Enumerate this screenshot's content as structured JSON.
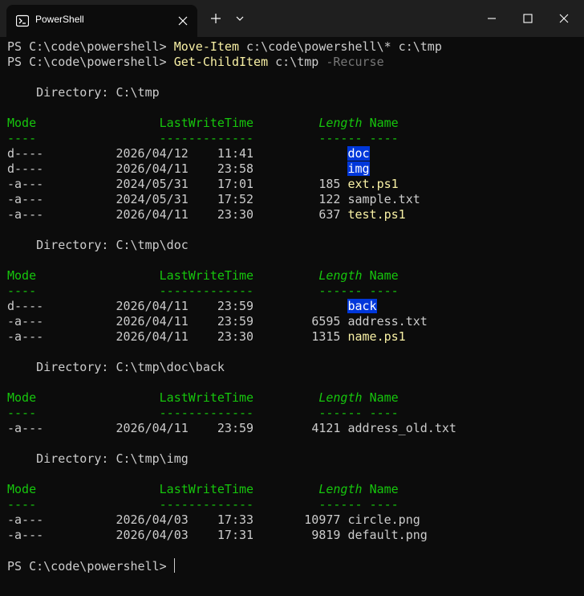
{
  "tab": {
    "title": "PowerShell"
  },
  "prompt": "PS C:\\code\\powershell> ",
  "commands": [
    {
      "name": "Move-Item",
      "args": " c:\\code\\powershell\\* c:\\tmp",
      "param": ""
    },
    {
      "name": "Get-ChildItem",
      "args": " c:\\tmp ",
      "param": "-Recurse"
    }
  ],
  "table_headers": {
    "mode": "Mode",
    "lastwritetime": "LastWriteTime",
    "length": "Length",
    "name": "Name",
    "mode_sep": "----",
    "lastwritetime_sep": "-------------",
    "length_sep": "------",
    "name_sep": "----"
  },
  "listings": [
    {
      "directory": "C:\\tmp",
      "rows": [
        {
          "mode": "d----",
          "date": "2026/04/12",
          "time": "11:41",
          "length": "",
          "name": "doc",
          "kind": "dir"
        },
        {
          "mode": "d----",
          "date": "2026/04/11",
          "time": "23:58",
          "length": "",
          "name": "img",
          "kind": "dir"
        },
        {
          "mode": "-a---",
          "date": "2024/05/31",
          "time": "17:01",
          "length": "185",
          "name": "ext.ps1",
          "kind": "script"
        },
        {
          "mode": "-a---",
          "date": "2024/05/31",
          "time": "17:52",
          "length": "122",
          "name": "sample.txt",
          "kind": "file"
        },
        {
          "mode": "-a---",
          "date": "2026/04/11",
          "time": "23:30",
          "length": "637",
          "name": "test.ps1",
          "kind": "script"
        }
      ]
    },
    {
      "directory": "C:\\tmp\\doc",
      "rows": [
        {
          "mode": "d----",
          "date": "2026/04/11",
          "time": "23:59",
          "length": "",
          "name": "back",
          "kind": "dir"
        },
        {
          "mode": "-a---",
          "date": "2026/04/11",
          "time": "23:59",
          "length": "6595",
          "name": "address.txt",
          "kind": "file"
        },
        {
          "mode": "-a---",
          "date": "2026/04/11",
          "time": "23:30",
          "length": "1315",
          "name": "name.ps1",
          "kind": "script"
        }
      ]
    },
    {
      "directory": "C:\\tmp\\doc\\back",
      "rows": [
        {
          "mode": "-a---",
          "date": "2026/04/11",
          "time": "23:59",
          "length": "4121",
          "name": "address_old.txt",
          "kind": "file"
        }
      ]
    },
    {
      "directory": "C:\\tmp\\img",
      "rows": [
        {
          "mode": "-a---",
          "date": "2026/04/03",
          "time": "17:33",
          "length": "10977",
          "name": "circle.png",
          "kind": "file"
        },
        {
          "mode": "-a---",
          "date": "2026/04/03",
          "time": "17:31",
          "length": "9819",
          "name": "default.png",
          "kind": "file"
        }
      ]
    }
  ],
  "colors": {
    "background": "#0c0c0c",
    "text": "#cccccc",
    "command": "#f9f1a5",
    "parameter": "#767676",
    "header": "#16c60c",
    "directory_highlight": "#0037da"
  },
  "icons": {
    "tab": "powershell-icon",
    "close": "close-icon",
    "new_tab": "plus-icon",
    "dropdown": "chevron-down-icon",
    "minimize": "minimize-icon",
    "maximize": "maximize-icon",
    "window_close": "window-close-icon"
  }
}
